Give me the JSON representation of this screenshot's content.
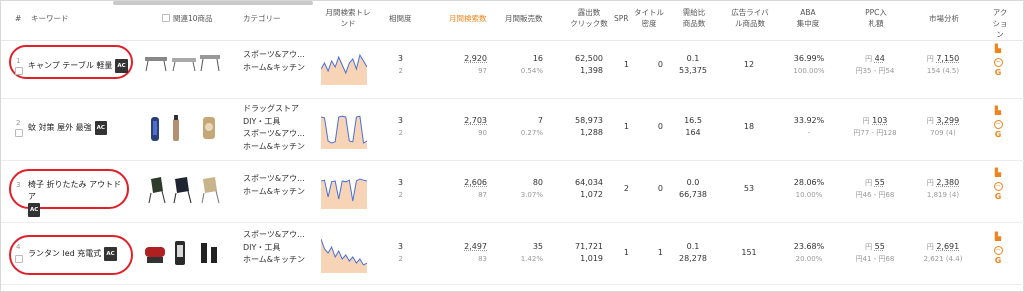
{
  "header": {
    "hash": "#",
    "keyword": "キーワード",
    "related": "関連10商品",
    "category": "カテゴリー",
    "trend_1": "月間検索トレ",
    "trend_2": "ンド",
    "match": "相関度",
    "searches": "月間検索数",
    "sales": "月間販売数",
    "exposure_1": "露出数",
    "exposure_2": "クリック数",
    "spr": "SPR",
    "title_1": "タイトル",
    "title_2": "密度",
    "supply_1": "需給比",
    "supply_2": "商品数",
    "ad_1": "広告ライバ",
    "ad_2": "ル商品数",
    "aba_1": "ABA",
    "aba_2": "集中度",
    "ppc_1": "PPC入",
    "ppc_2": "札額",
    "market": "市場分析",
    "action_1": "アク",
    "action_2": "ション"
  },
  "colors": {
    "orange": "#f0841c",
    "annotation": "#e0202a",
    "trend_line": "#4a6fd6",
    "trend_fill": "#f5c9a3"
  },
  "rows": [
    {
      "index": "1",
      "keyword": "キャンプ テーブル 軽量",
      "badge": "AC",
      "category": [
        "スポーツ&アウ...",
        "ホーム&キッチン"
      ],
      "match": "3",
      "match_sub": "2",
      "searches": "2,920",
      "searches_sub": "97",
      "sales": "16",
      "sales_sub": "0.54%",
      "exposure": "62,500",
      "clicks": "1,398",
      "spr": "1",
      "title": "0",
      "supply": "0.1",
      "supply_sub": "53,375",
      "ad": "12",
      "aba": "36.99%",
      "aba_sub": "100.00%",
      "ppc": "44",
      "ppc_range": "円35 - 円54",
      "market": "7,150",
      "market_sub": "154 (4.5)",
      "trend": [
        40,
        55,
        35,
        60,
        45,
        70,
        50,
        30,
        55,
        65,
        40,
        75,
        60,
        45
      ]
    },
    {
      "index": "2",
      "keyword": "蚊 対策 屋外 最強",
      "badge": "AC",
      "category": [
        "ドラッグストア",
        "DIY・工具",
        "スポーツ&アウ...",
        "ホーム&キッチン"
      ],
      "match": "3",
      "match_sub": "2",
      "searches": "2,703",
      "searches_sub": "90",
      "sales": "7",
      "sales_sub": "0.27%",
      "exposure": "58,973",
      "clicks": "1,288",
      "spr": "1",
      "title": "0",
      "supply": "16.5",
      "supply_sub": "164",
      "ad": "18",
      "aba": "33.92%",
      "aba_sub": "-",
      "ppc": "103",
      "ppc_range": "円77 - 円128",
      "market": "3,299",
      "market_sub": "709 (4)",
      "trend": [
        80,
        78,
        20,
        15,
        18,
        80,
        82,
        80,
        20,
        18,
        80,
        82,
        15,
        20
      ]
    },
    {
      "index": "3",
      "keyword": "椅子 折りたたみ アウトドア",
      "badge": "AC",
      "category": [
        "スポーツ&アウ...",
        "ホーム&キッチン"
      ],
      "match": "3",
      "match_sub": "2",
      "searches": "2,606",
      "searches_sub": "87",
      "sales": "80",
      "sales_sub": "3.07%",
      "exposure": "64,034",
      "clicks": "1,072",
      "spr": "2",
      "title": "0",
      "supply": "0.0",
      "supply_sub": "66,738",
      "ad": "53",
      "aba": "28.06%",
      "aba_sub": "10.00%",
      "ppc": "55",
      "ppc_range": "円46 - 円68",
      "market": "2,380",
      "market_sub": "1,819 (4)",
      "trend": [
        70,
        72,
        30,
        68,
        70,
        25,
        70,
        68,
        72,
        20,
        70,
        75,
        72,
        70
      ]
    },
    {
      "index": "4",
      "keyword": "ランタン led 充電式",
      "badge": "AC",
      "category": [
        "スポーツ&アウ...",
        "DIY・工具",
        "ホーム&キッチン"
      ],
      "match": "3",
      "match_sub": "2",
      "searches": "2,497",
      "searches_sub": "83",
      "sales": "35",
      "sales_sub": "1.42%",
      "exposure": "71,721",
      "clicks": "1,019",
      "spr": "1",
      "title": "1",
      "supply": "0.1",
      "supply_sub": "28,278",
      "ad": "151",
      "aba": "23.68%",
      "aba_sub": "20.00%",
      "ppc": "55",
      "ppc_range": "円41 - 円68",
      "market": "2,691",
      "market_sub": "2,621 (4.4)",
      "trend": [
        85,
        60,
        50,
        65,
        40,
        55,
        35,
        45,
        30,
        40,
        25,
        35,
        20,
        25
      ]
    }
  ],
  "yen": "円",
  "icons": [
    "bar-chart-icon",
    "circle-minus-icon",
    "google-icon"
  ]
}
